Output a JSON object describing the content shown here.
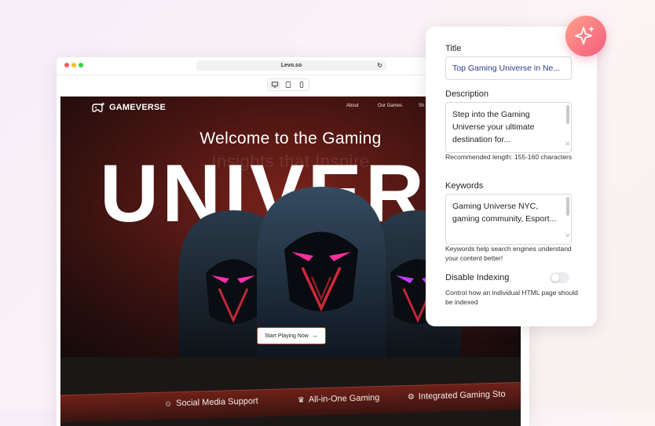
{
  "browser": {
    "url": "Levo.so"
  },
  "site": {
    "logo_text": "GAMEVERSE",
    "nav": [
      "About",
      "Our Games",
      "Sh"
    ],
    "hero_title": "Welcome to the Gaming",
    "hero_ghost": "Insights that Inspire",
    "hero_big": "UNIVERSE",
    "cta_label": "Start Playing Now",
    "band": [
      "Social Media Support",
      "All-in-One Gaming",
      "Integrated Gaming Sto"
    ]
  },
  "seo_panel": {
    "title_label": "Title",
    "title_value": "Top Gaming Universe in Ne...",
    "description_label": "Description",
    "description_value": "Step into the Gaming Universe your ultimate destination for...",
    "description_help": "Recommended length: 155-160 characters",
    "keywords_label": "Keywords",
    "keywords_value": "Gaming Universe NYC, gaming community, Esport...",
    "keywords_help": "Keywords help search engines understand your content better!",
    "indexing_label": "Disable Indexing",
    "indexing_help": "Control how an individual HTML page should be indexed",
    "indexing_enabled": false
  },
  "colors": {
    "accent_gradient_start": "#ffa08a",
    "accent_gradient_end": "#f45b7e",
    "title_value_color": "#2b3a8f",
    "cta_border": "#c23a2e"
  },
  "icons": [
    "sparkle-icon",
    "controller-icon",
    "reload-icon",
    "desktop-icon",
    "tablet-icon",
    "mobile-icon",
    "arrow-right-icon"
  ]
}
